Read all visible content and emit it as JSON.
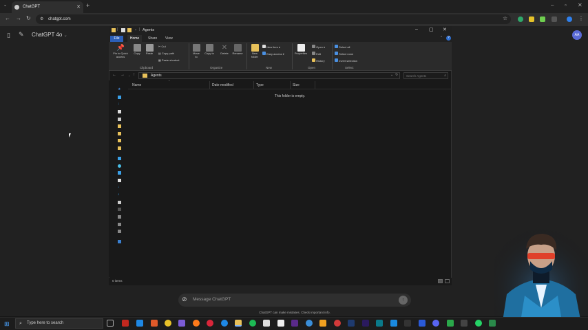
{
  "browser": {
    "tab_title": "ChatGPT",
    "url": "chatgpt.com"
  },
  "chatgpt": {
    "model_label": "ChatGPT 4o",
    "avatar_initials": "AA",
    "composer_placeholder": "Message ChatGPT",
    "disclaimer": "ChatGPT can make mistakes. Check important info."
  },
  "explorer": {
    "window_title": "Agents",
    "ribbon_tabs": [
      "File",
      "Home",
      "Share",
      "View"
    ],
    "clipboard": {
      "pin": "Pin to Quick access",
      "copy": "Copy",
      "paste": "Paste",
      "cut": "Cut",
      "copy_path": "Copy path",
      "paste_shortcut": "Paste shortcut",
      "group": "Clipboard"
    },
    "organize": {
      "move_to": "Move to",
      "copy_to": "Copy to",
      "delete": "Delete",
      "rename": "Rename",
      "group": "Organize"
    },
    "new": {
      "new_folder": "New folder",
      "new_item": "New item",
      "easy_access": "Easy access",
      "group": "New"
    },
    "open": {
      "properties": "Properties",
      "open": "Open",
      "edit": "Edit",
      "history": "History",
      "group": "Open"
    },
    "select": {
      "select_all": "Select all",
      "select_none": "Select none",
      "invert": "Invert selection",
      "group": "Select"
    },
    "address": "Agents",
    "search_placeholder": "Search Agents",
    "columns": [
      "Name",
      "Date modified",
      "Type",
      "Size"
    ],
    "empty_message": "This folder is empty.",
    "status": "0 items"
  },
  "taskbar": {
    "search_placeholder": "Type here to search"
  },
  "colors": {
    "explorer_bg": "#191919",
    "ribbon_bg": "#2b2b2b",
    "file_tab": "#2c5fb8",
    "folder": "#e8c15a",
    "avatar": "#5a6ad6"
  }
}
